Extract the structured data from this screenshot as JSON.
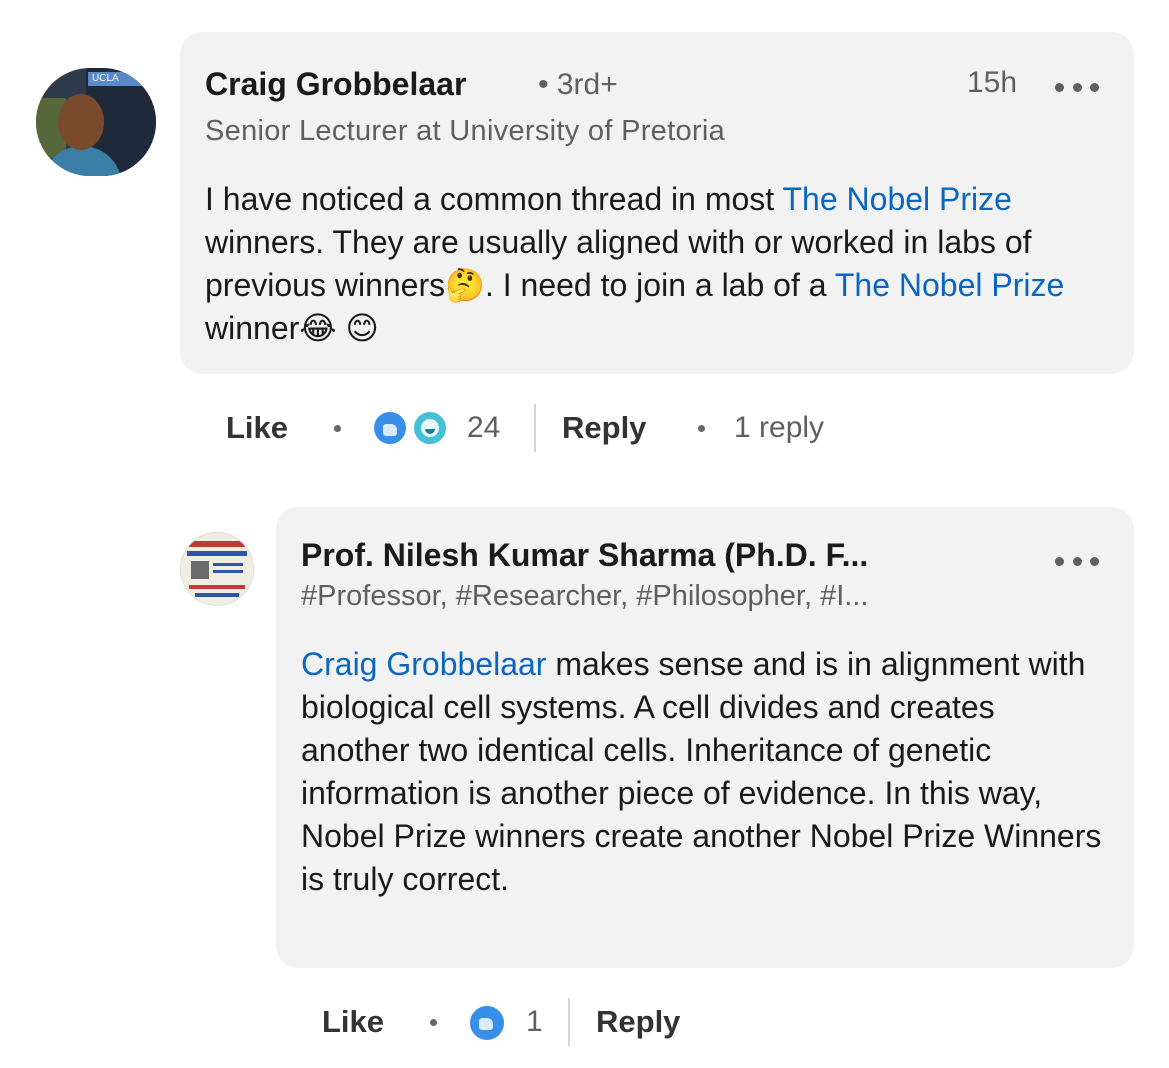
{
  "comment": {
    "author": "Craig Grobbelaar",
    "degree": "• 3rd+",
    "time": "15h",
    "headline": "Senior Lecturer at University of Pretoria",
    "text_parts": {
      "p1": "I have noticed a common thread in most ",
      "link1": "The Nobel Prize",
      "p2": " winners. They are usually aligned with or worked in labs of previous winners",
      "emoji1": "🤔",
      "p3": ". I need to join a lab of a ",
      "link2": "The Nobel Prize",
      "p4": " winner",
      "emoji2": "😂",
      "emoji3": "😊"
    },
    "actions": {
      "like_label": "Like",
      "reaction_count": "24",
      "reply_label": "Reply",
      "replies_label": "1 reply"
    },
    "reactions": [
      "like",
      "funny"
    ]
  },
  "reply": {
    "author": "Prof. Nilesh Kumar Sharma (Ph.D. F...",
    "headline": "#Professor, #Researcher, #Philosopher, #I...",
    "text_parts": {
      "mention": "Craig Grobbelaar",
      "rest": " makes sense and is in alignment with biological cell systems. A cell divides and creates another two identical cells. Inheritance of genetic information is another piece of evidence. In this way, Nobel Prize winners create another Nobel Prize Winners is truly correct."
    },
    "actions": {
      "like_label": "Like",
      "reaction_count": "1",
      "reply_label": "Reply"
    },
    "reactions": [
      "like"
    ]
  }
}
